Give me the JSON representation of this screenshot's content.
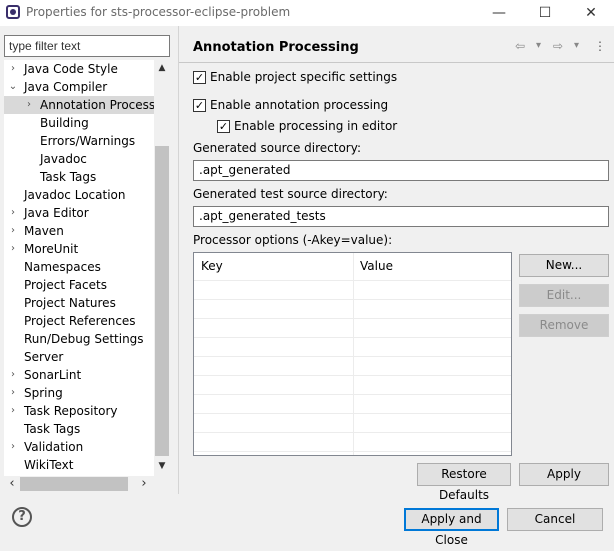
{
  "window": {
    "title": "Properties for sts-processor-eclipse-problem",
    "minimize_glyph": "—",
    "maximize_glyph": "☐",
    "close_glyph": "✕"
  },
  "sidebar": {
    "filter_placeholder": "type filter text",
    "items": [
      {
        "label": "Java Code Style",
        "expander": "›"
      },
      {
        "label": "Java Compiler",
        "expander": "⌄"
      },
      {
        "label": "Annotation Processing",
        "expander": "›",
        "selected": true
      },
      {
        "label": "Building",
        "expander": ""
      },
      {
        "label": "Errors/Warnings",
        "expander": ""
      },
      {
        "label": "Javadoc",
        "expander": ""
      },
      {
        "label": "Task Tags",
        "expander": ""
      },
      {
        "label": "Javadoc Location",
        "expander": ""
      },
      {
        "label": "Java Editor",
        "expander": "›"
      },
      {
        "label": "Maven",
        "expander": "›"
      },
      {
        "label": "MoreUnit",
        "expander": "›"
      },
      {
        "label": "Namespaces",
        "expander": ""
      },
      {
        "label": "Project Facets",
        "expander": ""
      },
      {
        "label": "Project Natures",
        "expander": ""
      },
      {
        "label": "Project References",
        "expander": ""
      },
      {
        "label": "Run/Debug Settings",
        "expander": ""
      },
      {
        "label": "Server",
        "expander": ""
      },
      {
        "label": "SonarLint",
        "expander": "›"
      },
      {
        "label": "Spring",
        "expander": "›"
      },
      {
        "label": "Task Repository",
        "expander": "›"
      },
      {
        "label": "Task Tags",
        "expander": ""
      },
      {
        "label": "Validation",
        "expander": "›"
      },
      {
        "label": "WikiText",
        "expander": ""
      }
    ],
    "scroll_up": "▲",
    "scroll_down": "▼",
    "scroll_left": "‹",
    "scroll_right": "›"
  },
  "page": {
    "title": "Annotation Processing",
    "nav_back": "⇦",
    "nav_forward": "⇨",
    "nav_menu": "▾",
    "nav_more": "⋮",
    "enable_project_settings": {
      "label": "Enable project specific settings",
      "checked": true
    },
    "enable_annotation_processing": {
      "label": "Enable annotation processing",
      "checked": true
    },
    "enable_in_editor": {
      "label": "Enable processing in editor",
      "checked": true
    },
    "gen_source_label": "Generated source directory:",
    "gen_source_value": ".apt_generated",
    "gen_test_label": "Generated test source directory:",
    "gen_test_value": ".apt_generated_tests",
    "processor_options_label": "Processor options (-Akey=value):",
    "table": {
      "columns": [
        "Key",
        "Value"
      ]
    },
    "buttons": {
      "new": "New...",
      "edit": "Edit...",
      "remove": "Remove"
    }
  },
  "footer": {
    "help": "?",
    "restore_defaults": "Restore Defaults",
    "apply": "Apply",
    "apply_and_close": "Apply and Close",
    "cancel": "Cancel"
  }
}
